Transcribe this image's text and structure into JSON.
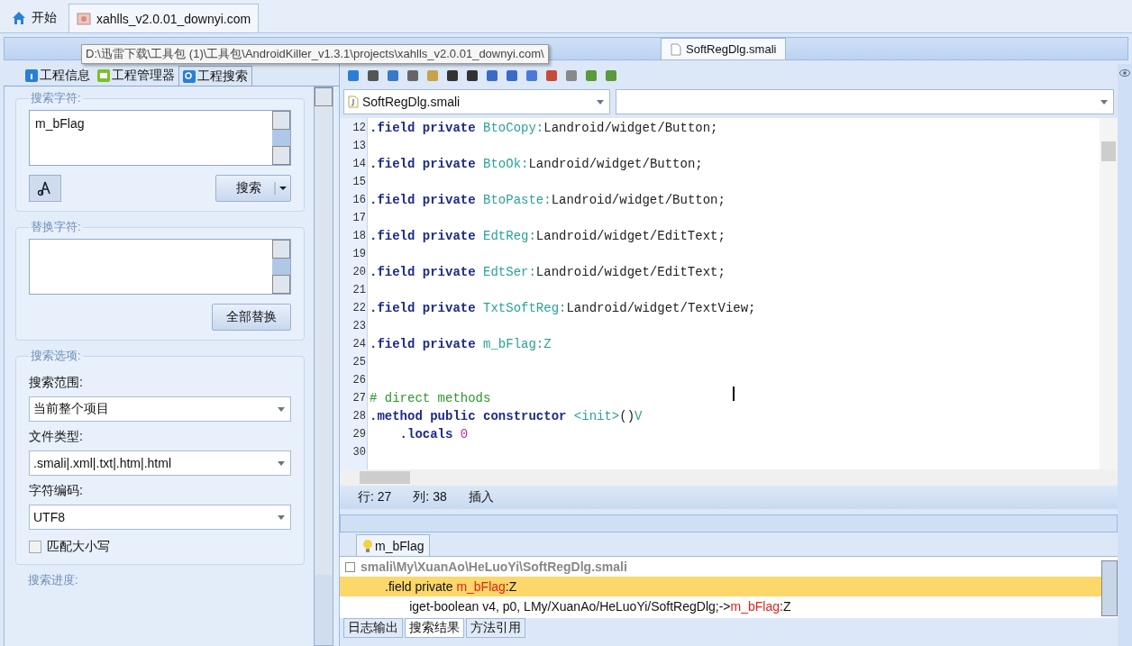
{
  "top_tabs": [
    {
      "label": "开始",
      "kind": "home",
      "selected": false
    },
    {
      "label": "xahlls_v2.0.01_downyi.com",
      "kind": "project",
      "selected": true
    }
  ],
  "tooltip": "D:\\迅雷下载\\工具包 (1)\\工具包\\AndroidKiller_v1.3.1\\projects\\xahlls_v2.0.01_downyi.com\\",
  "file_tabs": [
    {
      "label": "SoftRegDlg.smali",
      "selected": true
    }
  ],
  "left_tabs": [
    {
      "label": "工程信息",
      "kind": "info",
      "selected": false
    },
    {
      "label": "工程管理器",
      "kind": "manager",
      "selected": false
    },
    {
      "label": "工程搜索",
      "kind": "search",
      "selected": true
    }
  ],
  "search_group": {
    "title": "搜索字符:",
    "value": "m_bFlag",
    "button": "搜索"
  },
  "replace_group": {
    "title": "替换字符:",
    "button": "全部替换"
  },
  "options_group": {
    "title": "搜索选项:",
    "fields": [
      {
        "label": "搜索范围:",
        "value": "当前整个项目"
      },
      {
        "label": "文件类型:",
        "value": ".smali|.xml|.txt|.htm|.html"
      },
      {
        "label": "字符编码:",
        "value": "UTF8"
      }
    ],
    "match_case": {
      "label": "匹配大小写",
      "checked": false
    }
  },
  "progress_group": {
    "title": "搜索进度:"
  },
  "editor": {
    "file_combo": "SoftRegDlg.smali",
    "lines": [
      {
        "num": "12",
        "tokens": [
          {
            "t": ".field private ",
            "kind": "keyword"
          },
          {
            "t": "BtoCopy:",
            "kind": "ident"
          },
          {
            "t": "Landroid/widget/Button;",
            "kind": "type"
          }
        ]
      },
      {
        "num": "13"
      },
      {
        "num": "14",
        "tokens": [
          {
            "t": ".field private ",
            "kind": "keyword"
          },
          {
            "t": "BtoOk:",
            "kind": "ident"
          },
          {
            "t": "Landroid/widget/Button;",
            "kind": "type"
          }
        ]
      },
      {
        "num": "15"
      },
      {
        "num": "16",
        "tokens": [
          {
            "t": ".field private ",
            "kind": "keyword"
          },
          {
            "t": "BtoPaste:",
            "kind": "ident"
          },
          {
            "t": "Landroid/widget/Button;",
            "kind": "type"
          }
        ]
      },
      {
        "num": "17"
      },
      {
        "num": "18",
        "tokens": [
          {
            "t": ".field private ",
            "kind": "keyword"
          },
          {
            "t": "EdtReg:",
            "kind": "ident"
          },
          {
            "t": "Landroid/widget/EditText;",
            "kind": "type"
          }
        ]
      },
      {
        "num": "19"
      },
      {
        "num": "20",
        "tokens": [
          {
            "t": ".field private ",
            "kind": "keyword"
          },
          {
            "t": "EdtSer:",
            "kind": "ident"
          },
          {
            "t": "Landroid/widget/EditText;",
            "kind": "type"
          }
        ]
      },
      {
        "num": "21"
      },
      {
        "num": "22",
        "tokens": [
          {
            "t": ".field private ",
            "kind": "keyword"
          },
          {
            "t": "TxtSoftReg:",
            "kind": "ident"
          },
          {
            "t": "Landroid/widget/TextView;",
            "kind": "type"
          }
        ]
      },
      {
        "num": "23"
      },
      {
        "num": "24",
        "tokens": [
          {
            "t": ".field private ",
            "kind": "keyword"
          },
          {
            "t": "m_bFlag:Z",
            "kind": "ident"
          }
        ]
      },
      {
        "num": "25"
      },
      {
        "num": "26"
      },
      {
        "num": "27",
        "tokens": [
          {
            "t": "# direct methods",
            "kind": "comment"
          }
        ]
      },
      {
        "num": "28",
        "tokens": [
          {
            "t": ".method public constructor ",
            "kind": "keyword"
          },
          {
            "t": "<init>",
            "kind": "ident"
          },
          {
            "t": "()",
            "kind": "type"
          },
          {
            "t": "V",
            "kind": "ident"
          }
        ]
      },
      {
        "num": "29",
        "tokens": [
          {
            "t": "    .locals ",
            "kind": "keyword"
          },
          {
            "t": "0",
            "kind": "number"
          }
        ]
      },
      {
        "num": "30"
      }
    ],
    "status": [
      {
        "t": "行: 27"
      },
      {
        "t": "列: 38"
      },
      {
        "t": "插入"
      }
    ]
  },
  "results": {
    "tab": "m_bFlag",
    "file": "smali\\My\\XuanAo\\HeLuoYi\\SoftRegDlg.smali",
    "rows": [
      {
        "before": ".field private ",
        "match": "m_bFlag",
        "after": ":Z",
        "selected": true
      },
      {
        "before": "       iget-boolean v4, p0, LMy/XuanAo/HeLuoYi/SoftRegDlg;->",
        "match": "m_bFlag",
        "after": ":Z",
        "selected": false
      }
    ]
  },
  "bottom_tabs": [
    {
      "label": "日志输出",
      "selected": false
    },
    {
      "label": "搜索结果",
      "selected": true
    },
    {
      "label": "方法引用",
      "selected": false
    }
  ]
}
